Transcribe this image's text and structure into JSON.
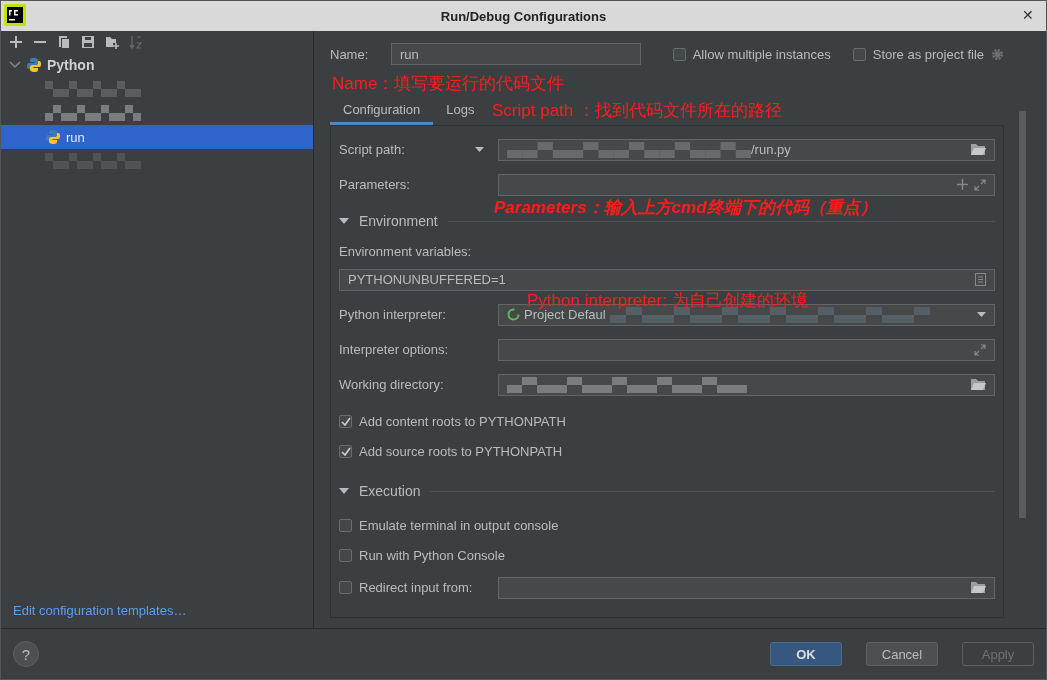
{
  "window": {
    "title": "Run/Debug Configurations",
    "close": "✕"
  },
  "tree": [
    {
      "label": "Python",
      "expanded": true,
      "children": [
        {
          "kind": "redacted",
          "selected": false
        },
        {
          "kind": "redacted",
          "selected": false
        },
        {
          "kind": "config",
          "label": "run",
          "selected": true
        },
        {
          "kind": "redacted",
          "selected": false
        }
      ]
    }
  ],
  "templates_link": "Edit configuration templates…",
  "name": {
    "label": "Name:",
    "value": "run",
    "note": "Name：填写要运行的代码文件"
  },
  "options": [
    {
      "label": "Allow multiple instances",
      "checked": false
    },
    {
      "label": "Store as project file",
      "checked": false
    }
  ],
  "tabs": [
    {
      "label": "Configuration",
      "selected": true
    },
    {
      "label": "Logs",
      "selected": false
    }
  ],
  "tabs_note": "Script path ：找到代码文件所在的路径",
  "script_path": {
    "label": "Script path:",
    "value": "/run.py"
  },
  "parameters": {
    "label": "Parameters:",
    "note": "Parameters：输入上方cmd终端下的代码（重点）"
  },
  "environment": {
    "title": "Environment",
    "expanded": true
  },
  "env_vars": {
    "label": "Environment variables:",
    "value": "PYTHONUNBUFFERED=1",
    "note": "Python interpreter: 为自己创建的环境"
  },
  "interpreter": {
    "label": "Python interpreter:",
    "value": "Project Defaul"
  },
  "interpreter_options": {
    "label": "Interpreter options:"
  },
  "working_dir": {
    "label": "Working directory:"
  },
  "path_options": [
    {
      "label": "Add content roots to PYTHONPATH",
      "checked": true
    },
    {
      "label": "Add source roots to PYTHONPATH",
      "checked": true
    }
  ],
  "execution": {
    "title": "Execution",
    "expanded": true
  },
  "execution_options": [
    {
      "label": "Emulate terminal in output console",
      "checked": false
    },
    {
      "label": "Run with Python Console",
      "checked": false
    },
    {
      "label": "Redirect input from:",
      "checked": false
    }
  ],
  "help": "?",
  "buttons": [
    {
      "label": "OK",
      "kind": "primary",
      "disabled": false
    },
    {
      "label": "Cancel",
      "kind": "normal",
      "disabled": false
    },
    {
      "label": "Apply",
      "kind": "normal",
      "disabled": true
    }
  ]
}
